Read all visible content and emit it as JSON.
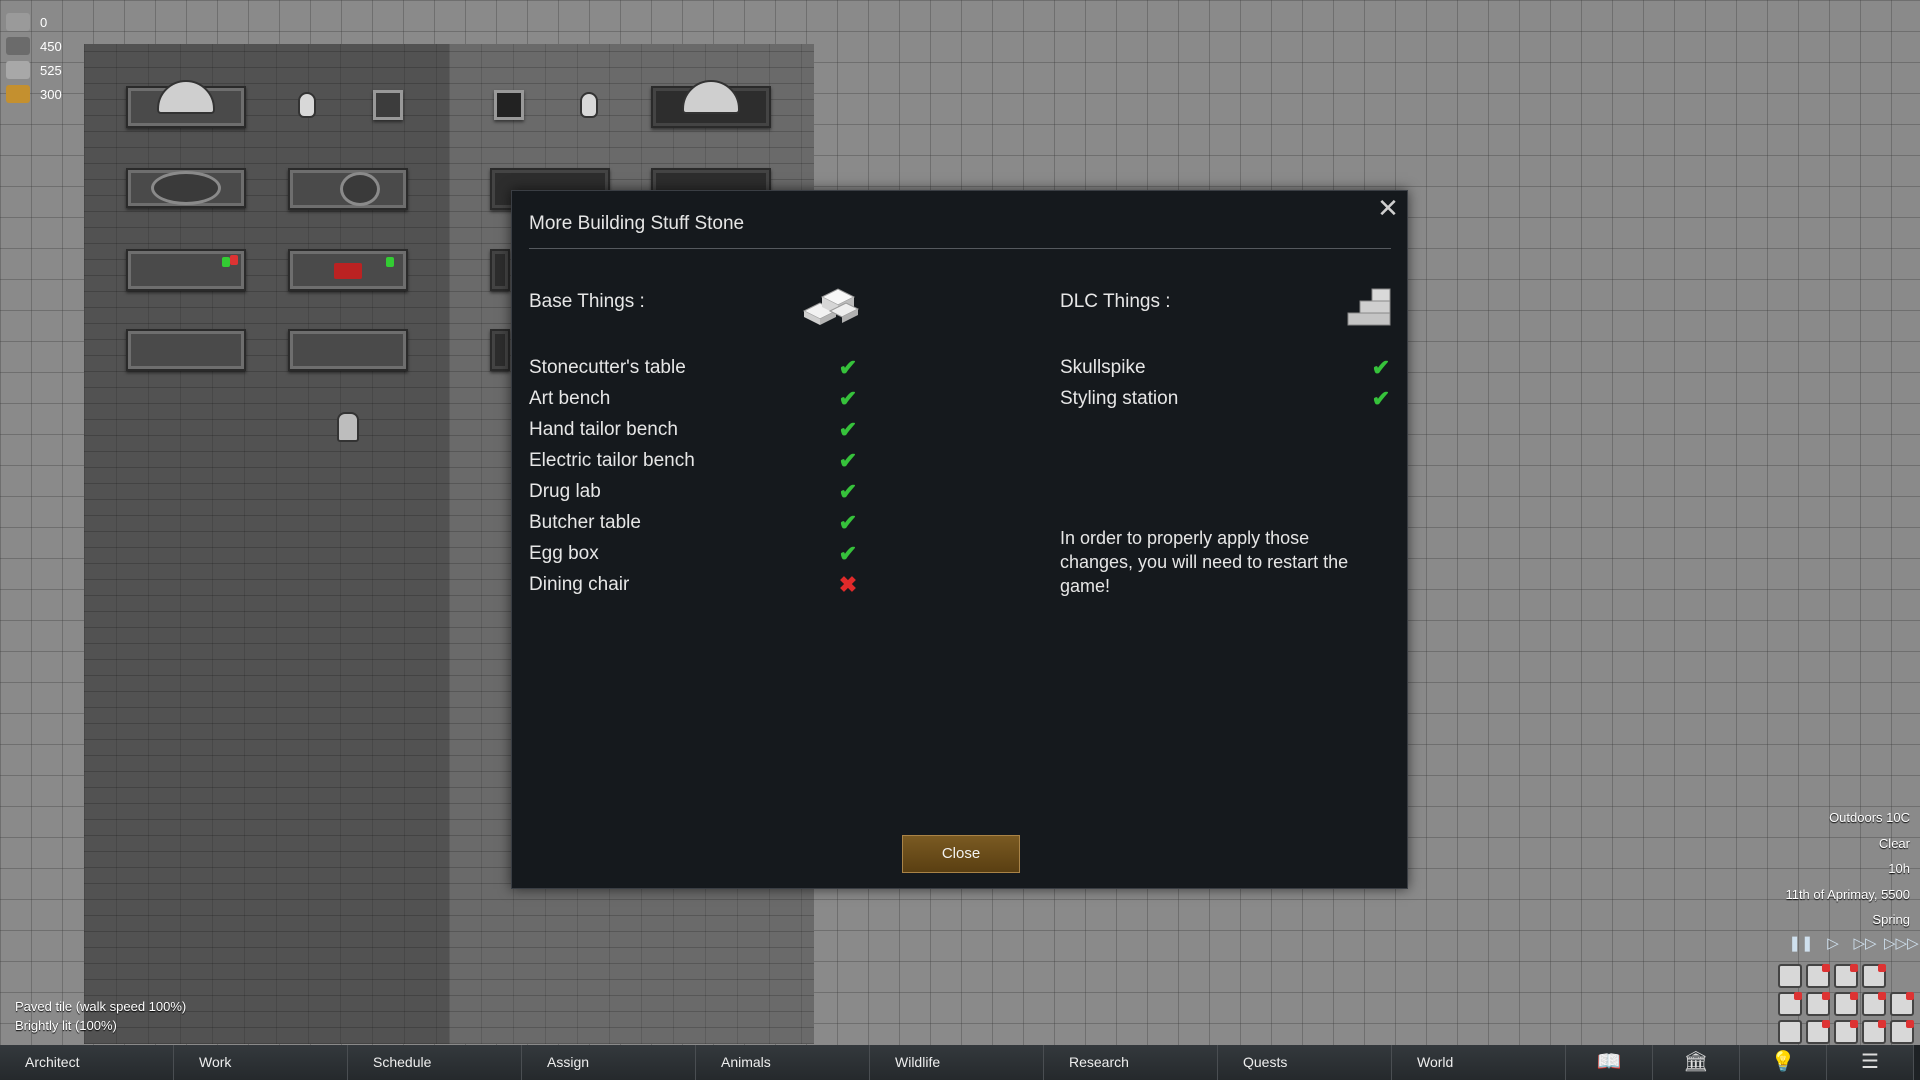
{
  "resources": [
    {
      "icon": "colonist-icon",
      "value": "0",
      "color": "#9a9a9a"
    },
    {
      "icon": "stone-blocks-icon",
      "value": "450",
      "color": "#6b6b6b"
    },
    {
      "icon": "steel-icon",
      "value": "525",
      "color": "#a8a8a8"
    },
    {
      "icon": "wood-icon",
      "value": "300",
      "color": "#c4902f"
    }
  ],
  "dialog": {
    "title": "More Building Stuff Stone",
    "base_label": "Base Things :",
    "dlc_label": "DLC Things :",
    "base_items": [
      {
        "label": "Stonecutter's table",
        "status": "ok"
      },
      {
        "label": "Art bench",
        "status": "ok"
      },
      {
        "label": "Hand tailor bench",
        "status": "ok"
      },
      {
        "label": "Electric tailor bench",
        "status": "ok"
      },
      {
        "label": "Drug lab",
        "status": "ok"
      },
      {
        "label": "Butcher table",
        "status": "ok"
      },
      {
        "label": "Egg box",
        "status": "ok"
      },
      {
        "label": "Dining chair",
        "status": "no"
      }
    ],
    "dlc_items": [
      {
        "label": "Skullspike",
        "status": "ok"
      },
      {
        "label": "Styling station",
        "status": "ok"
      }
    ],
    "notice": "In order to properly apply those changes, you will need to restart the game!",
    "close_label": "Close",
    "ok_glyph": "✔",
    "no_glyph": "✖",
    "close_glyph": "✕"
  },
  "tile_info": {
    "line1": "Paved tile (walk speed 100%)",
    "line2": "Brightly lit (100%)"
  },
  "weather": {
    "outdoors": "Outdoors 10C",
    "condition": "Clear",
    "hour": "10h",
    "date": "11th of Aprimay, 5500",
    "season": "Spring"
  },
  "speed_controls": [
    "pause-icon",
    "play-icon",
    "fast-icon",
    "superfast-icon"
  ],
  "bottom_tabs": [
    "Architect",
    "Work",
    "Schedule",
    "Assign",
    "Animals",
    "Wildlife",
    "Research",
    "Quests",
    "World"
  ],
  "bottom_icons": [
    "book-icon",
    "factions-icon",
    "ideas-icon",
    "menu-icon"
  ]
}
